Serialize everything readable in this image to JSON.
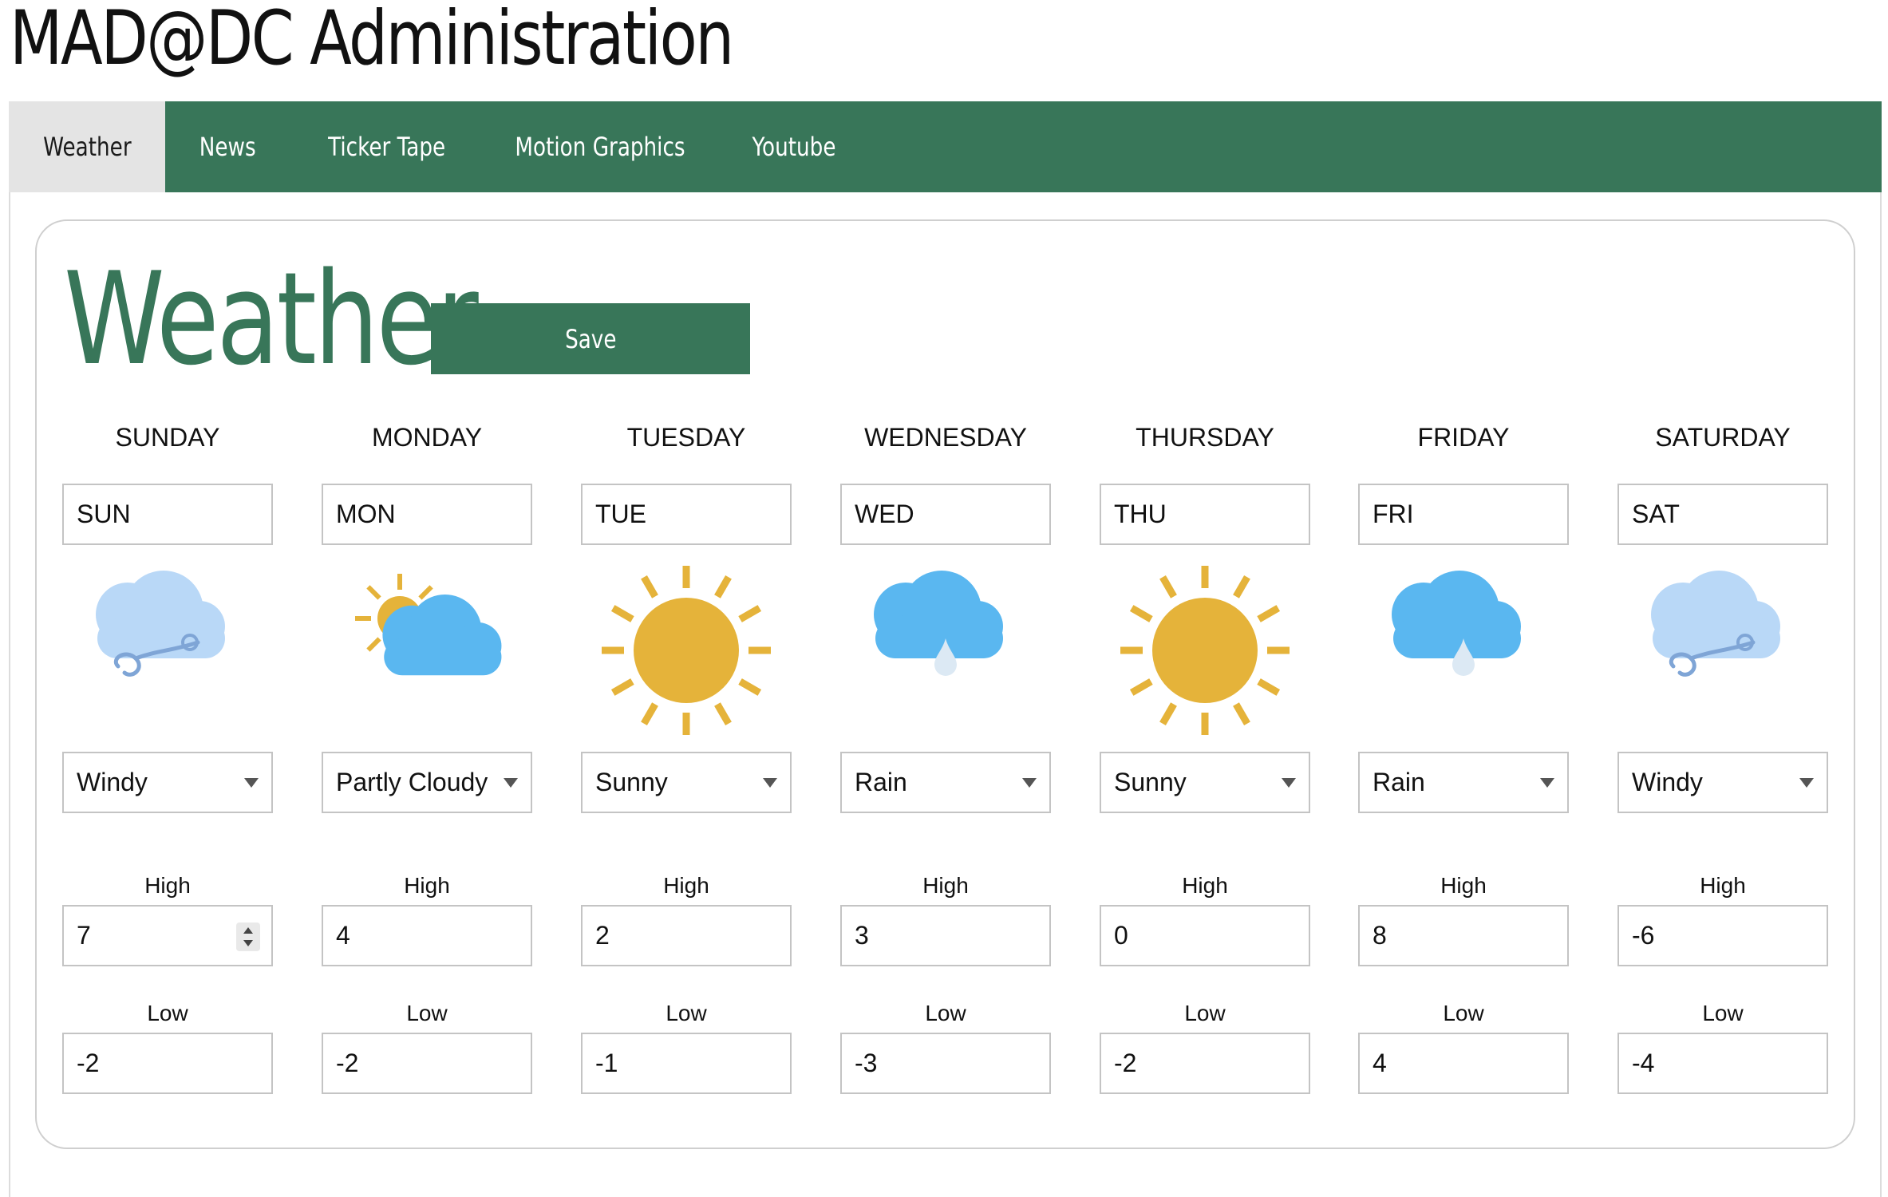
{
  "app": {
    "title": "MAD@DC Administration"
  },
  "nav": {
    "tabs": [
      {
        "label": "Weather",
        "active": true
      },
      {
        "label": "News",
        "active": false
      },
      {
        "label": "Ticker Tape",
        "active": false
      },
      {
        "label": "Motion Graphics",
        "active": false
      },
      {
        "label": "Youtube",
        "active": false
      }
    ]
  },
  "page": {
    "title": "Weather",
    "save_label": "Save"
  },
  "labels": {
    "high": "High",
    "low": "Low"
  },
  "colors": {
    "brand_green": "#387659",
    "sun_yellow": "#e5b33a",
    "cloud_blue": "#5ab7f0",
    "windy_cloud": "#b9d8f7"
  },
  "days": [
    {
      "name": "SUNDAY",
      "abbr": "SUN",
      "condition": "Windy",
      "icon": "windy-icon",
      "high": "7",
      "low": "-2"
    },
    {
      "name": "MONDAY",
      "abbr": "MON",
      "condition": "Partly Cloudy",
      "icon": "partly-cloudy-icon",
      "high": "4",
      "low": "-2"
    },
    {
      "name": "TUESDAY",
      "abbr": "TUE",
      "condition": "Sunny",
      "icon": "sunny-icon",
      "high": "2",
      "low": "-1"
    },
    {
      "name": "WEDNESDAY",
      "abbr": "WED",
      "condition": "Rain",
      "icon": "rain-icon",
      "high": "3",
      "low": "-3"
    },
    {
      "name": "THURSDAY",
      "abbr": "THU",
      "condition": "Sunny",
      "icon": "sunny-icon",
      "high": "0",
      "low": "-2"
    },
    {
      "name": "FRIDAY",
      "abbr": "FRI",
      "condition": "Rain",
      "icon": "rain-icon",
      "high": "8",
      "low": "4"
    },
    {
      "name": "SATURDAY",
      "abbr": "SAT",
      "condition": "Windy",
      "icon": "windy-icon",
      "high": "-6",
      "low": "-4"
    }
  ]
}
